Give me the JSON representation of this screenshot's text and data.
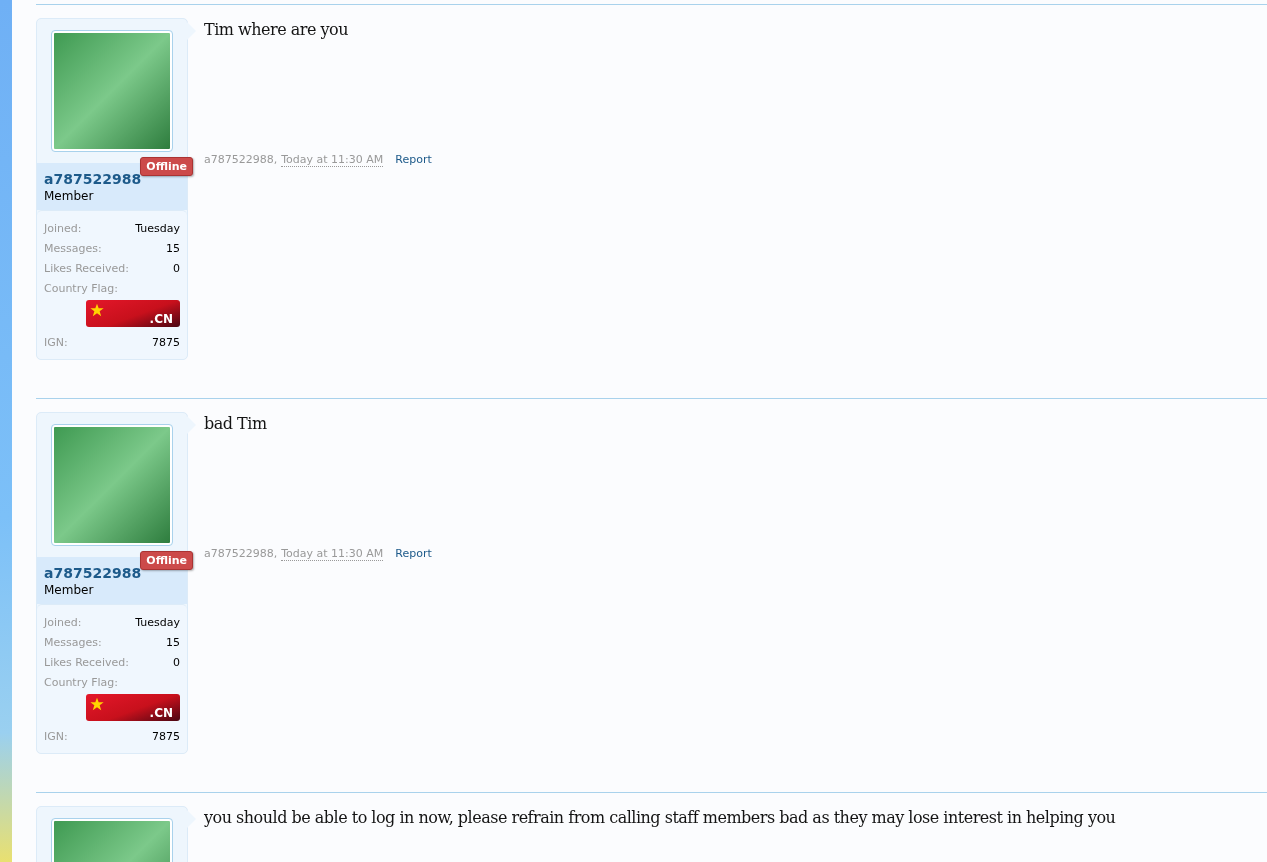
{
  "posts": [
    {
      "author": "a787522988",
      "role": "Member",
      "status": {
        "label": "Offline",
        "online": false
      },
      "stats": [
        {
          "kind": "text",
          "label": "Joined:",
          "value": "Tuesday"
        },
        {
          "kind": "text",
          "label": "Messages:",
          "value": "15"
        },
        {
          "kind": "text",
          "label": "Likes Received:",
          "value": "0"
        },
        {
          "kind": "flag",
          "label": "Country Flag:",
          "value": ".CN"
        },
        {
          "kind": "text",
          "label": "IGN:",
          "value": "7875"
        }
      ],
      "message": "Tim where are you",
      "meta": {
        "author": "a787522988,",
        "time": "Today at 11:30 AM",
        "report": "Report"
      }
    },
    {
      "author": "a787522988",
      "role": "Member",
      "status": {
        "label": "Offline",
        "online": false
      },
      "stats": [
        {
          "kind": "text",
          "label": "Joined:",
          "value": "Tuesday"
        },
        {
          "kind": "text",
          "label": "Messages:",
          "value": "15"
        },
        {
          "kind": "text",
          "label": "Likes Received:",
          "value": "0"
        },
        {
          "kind": "flag",
          "label": "Country Flag:",
          "value": ".CN"
        },
        {
          "kind": "text",
          "label": "IGN:",
          "value": "7875"
        }
      ],
      "message": "bad Tim",
      "meta": {
        "author": "a787522988,",
        "time": "Today at 11:30 AM",
        "report": "Report"
      }
    },
    {
      "message": "you should be able to log in now, please refrain from calling staff members bad as they may lose interest in helping you"
    }
  ]
}
